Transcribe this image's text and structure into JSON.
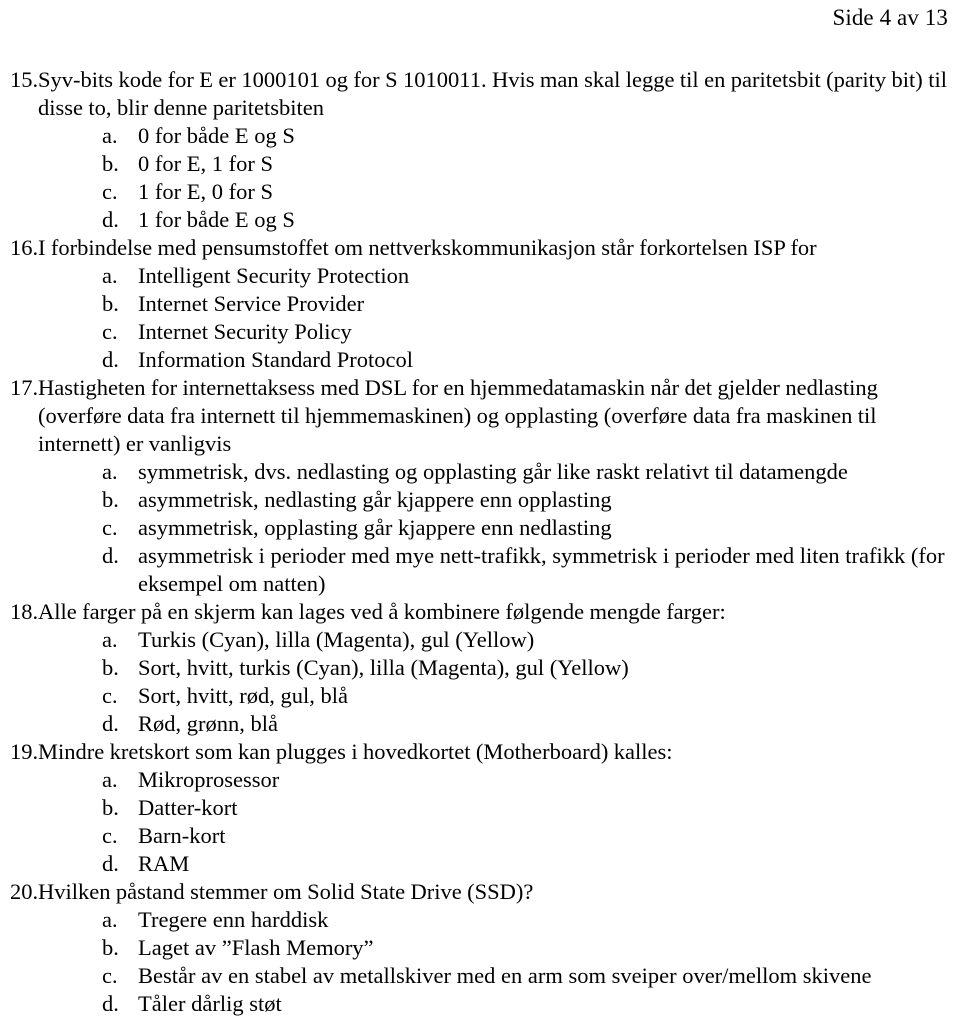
{
  "header": {
    "page_indicator": "Side 4 av 13"
  },
  "questions": [
    {
      "number": "15.",
      "text": "Syv-bits kode for E er 1000101 og for S 1010011. Hvis man skal legge til en paritetsbit (parity bit) til disse to, blir denne paritetsbiten",
      "options": [
        {
          "letter": "a.",
          "text": "0 for både E og S"
        },
        {
          "letter": "b.",
          "text": "0 for E, 1 for S"
        },
        {
          "letter": "c.",
          "text": "1 for E, 0 for S"
        },
        {
          "letter": "d.",
          "text": "1 for både E og S"
        }
      ]
    },
    {
      "number": "16.",
      "text": "I forbindelse med pensumstoffet om nettverkskommunikasjon står forkortelsen ISP for",
      "options": [
        {
          "letter": "a.",
          "text": "Intelligent Security Protection"
        },
        {
          "letter": "b.",
          "text": "Internet Service Provider"
        },
        {
          "letter": "c.",
          "text": "Internet Security Policy"
        },
        {
          "letter": "d.",
          "text": "Information Standard Protocol"
        }
      ]
    },
    {
      "number": "17.",
      "text": "Hastigheten for internettaksess med DSL for en hjemmedatamaskin når det gjelder nedlasting (overføre data fra internett til hjemmemaskinen) og opplasting (overføre data fra maskinen til internett) er vanligvis",
      "options": [
        {
          "letter": "a.",
          "text": "symmetrisk, dvs. nedlasting og opplasting går like raskt relativt til datamengde"
        },
        {
          "letter": "b.",
          "text": "asymmetrisk, nedlasting går kjappere enn opplasting"
        },
        {
          "letter": "c.",
          "text": "asymmetrisk, opplasting går kjappere enn nedlasting"
        },
        {
          "letter": "d.",
          "text": "asymmetrisk i perioder med mye nett-trafikk, symmetrisk i perioder med liten trafikk (for eksempel om natten)"
        }
      ]
    },
    {
      "number": "18.",
      "text": "Alle farger på en skjerm kan lages ved å kombinere følgende mengde farger:",
      "options": [
        {
          "letter": "a.",
          "text": "Turkis (Cyan), lilla (Magenta), gul (Yellow)"
        },
        {
          "letter": "b.",
          "text": "Sort, hvitt, turkis (Cyan), lilla (Magenta), gul (Yellow)"
        },
        {
          "letter": "c.",
          "text": "Sort, hvitt, rød, gul, blå"
        },
        {
          "letter": "d.",
          "text": "Rød, grønn, blå"
        }
      ]
    },
    {
      "number": "19.",
      "text": "Mindre kretskort som kan plugges i hovedkortet (Motherboard) kalles:",
      "options": [
        {
          "letter": "a.",
          "text": "Mikroprosessor"
        },
        {
          "letter": "b.",
          "text": "Datter-kort"
        },
        {
          "letter": "c.",
          "text": "Barn-kort"
        },
        {
          "letter": "d.",
          "text": "RAM"
        }
      ]
    },
    {
      "number": "20.",
      "text": "Hvilken påstand stemmer om Solid State Drive (SSD)?",
      "options": [
        {
          "letter": "a.",
          "text": "Tregere enn harddisk"
        },
        {
          "letter": "b.",
          "text": "Laget av ”Flash Memory”"
        },
        {
          "letter": "c.",
          "text": "Består av en stabel av metallskiver med en arm som sveiper over/mellom skivene"
        },
        {
          "letter": "d.",
          "text": "Tåler dårlig støt"
        }
      ]
    }
  ]
}
